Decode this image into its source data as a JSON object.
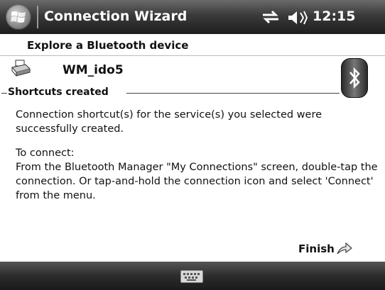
{
  "titlebar": {
    "title": "Connection Wizard",
    "time": "12:15",
    "icons": [
      "windows-start-icon",
      "connectivity-icon",
      "volume-icon"
    ]
  },
  "wizard": {
    "header": "Explore a Bluetooth device",
    "device_name": "WM_ido5",
    "device_icon": "printer-icon",
    "brand_icon": "bluetooth-icon",
    "section_title": "Shortcuts created",
    "message_1": "Connection shortcut(s)  for the service(s) you selected were successfully created.",
    "message_2_heading": "To connect:",
    "message_2_body": "From the Bluetooth Manager \"My Connections\" screen, double-tap the connection. Or tap-and-hold the connection icon and select 'Connect' from the menu.",
    "finish_label": "Finish"
  },
  "bottombar": {
    "icons": [
      "keyboard-icon"
    ]
  }
}
